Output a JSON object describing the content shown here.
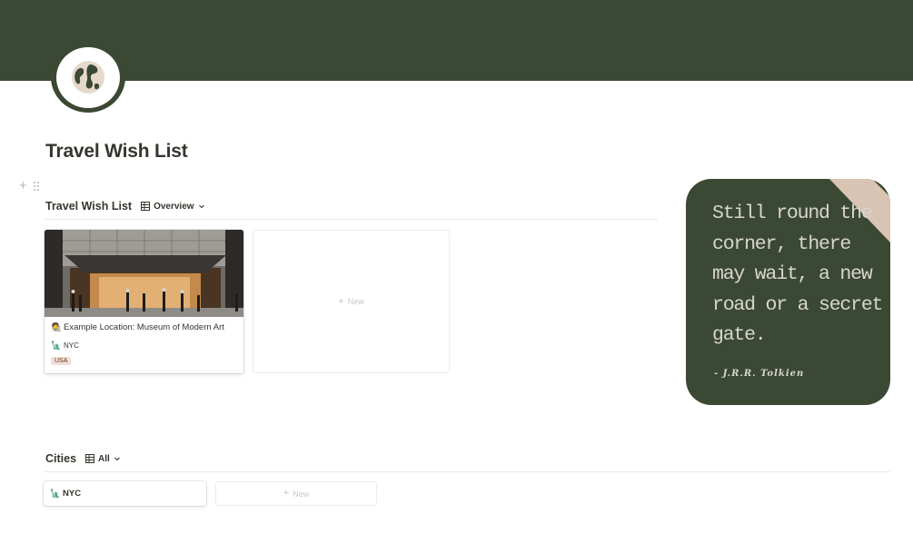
{
  "page": {
    "title": "Travel Wish List",
    "cover_color": "#3b4834",
    "icon": "globe-icon"
  },
  "block_controls": {
    "add_icon": "plus-icon",
    "drag_icon": "drag-handle-icon"
  },
  "travel_db": {
    "title": "Travel Wish List",
    "view_label": "Overview",
    "view_icon": "table-icon",
    "cards": [
      {
        "cover": "museum-entrance-image",
        "emoji": "🧑‍🎨",
        "name": "Example Location: Museum of Modern Art",
        "city_emoji": "🗽",
        "city": "NYC",
        "tag": "USA",
        "tag_color": "#f4dfd5"
      }
    ],
    "new_label": "New"
  },
  "quote": {
    "text": "Still round the corner, there may wait, a new road or a secret gate.",
    "author": "- J.R.R. Tolkien",
    "background": "#3b4834",
    "accent": "#d9c3b2"
  },
  "cities_db": {
    "title": "Cities",
    "view_label": "All",
    "view_icon": "table-icon",
    "items": [
      {
        "emoji": "🗽",
        "name": "NYC"
      }
    ],
    "new_label": "New"
  }
}
